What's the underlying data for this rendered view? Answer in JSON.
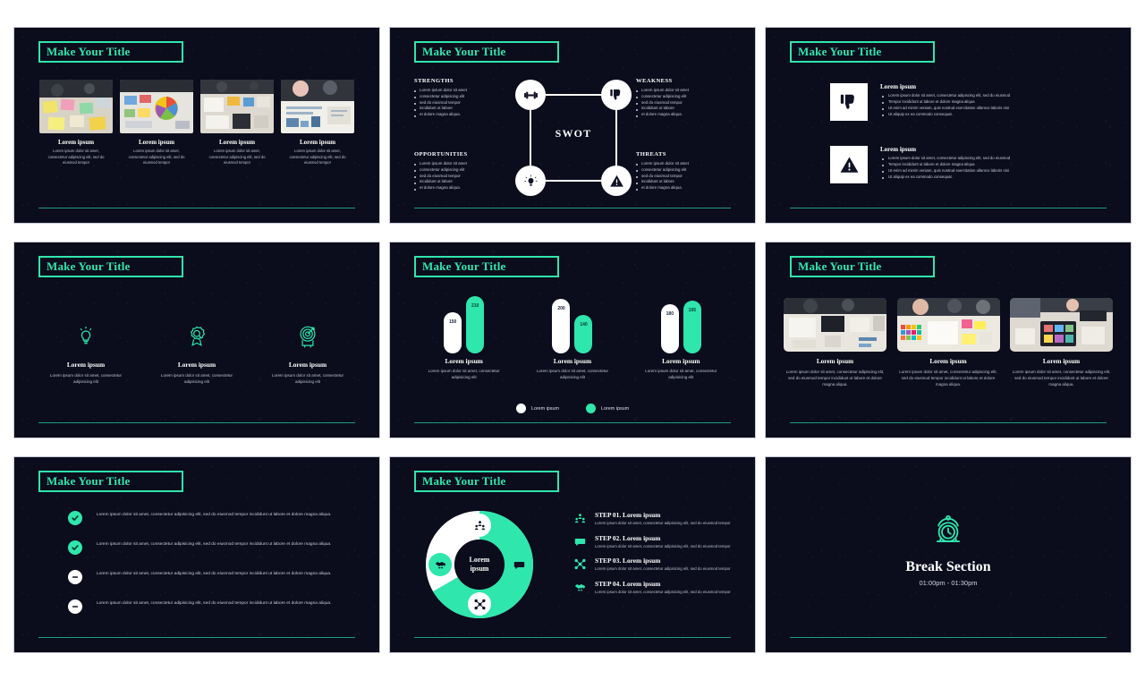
{
  "theme": {
    "accent": "#2fe6ad",
    "background": "#0b0c1c",
    "rule": "#1f9c7c",
    "white": "#ffffff"
  },
  "common": {
    "title": "Make Your Title",
    "lorem_heading": "Lorem ipsum"
  },
  "slides": [
    {
      "id": "slide-photo-grid-4",
      "title": "Make Your Title",
      "cards": [
        {
          "caption": "Lorem ipsum",
          "text": "Lorem ipsum dolor sit amet, consectetur adipiscing elit, sed do eiusmod tempor",
          "image": "team-sticky-notes-photo"
        },
        {
          "caption": "Lorem ipsum",
          "text": "Lorem ipsum dolor sit amet, consectetur adipiscing elit, sed do eiusmod tempor",
          "image": "color-wheel-design-photo"
        },
        {
          "caption": "Lorem ipsum",
          "text": "Lorem ipsum dolor sit amet, consectetur adipiscing elit, sed do eiusmod tempor",
          "image": "desk-wireframes-photo"
        },
        {
          "caption": "Lorem ipsum",
          "text": "Lorem ipsum dolor sit amet, consectetur adipiscing elit, sed do eiusmod tempor",
          "image": "blueprint-meeting-photo"
        }
      ]
    },
    {
      "id": "slide-swot",
      "title": "Make Your Title",
      "center_label": "SWOT",
      "quadrants": [
        {
          "key": "strengths",
          "heading": "STRENGTHS",
          "icon": "dumbbell-icon",
          "items": [
            "Lorem ipsum dolor sit amet",
            "consectetur adipiscing elit",
            "sed do eiusmod tempor",
            "incididunt ut labore",
            "et dolore magna aliqua."
          ]
        },
        {
          "key": "weakness",
          "heading": "WEAKNESS",
          "icon": "thumbs-down-icon",
          "items": [
            "Lorem ipsum dolor sit amet",
            "consectetur adipiscing elit",
            "sed do eiusmod tempor",
            "incididunt ut labore",
            "et dolore magna aliqua."
          ]
        },
        {
          "key": "opportunities",
          "heading": "OPPORTUNITIES",
          "icon": "lightbulb-icon",
          "items": [
            "Lorem ipsum dolor sit amet",
            "consectetur adipiscing elit",
            "sed do eiusmod tempor",
            "incididunt ut labore",
            "et dolore magna aliqua."
          ]
        },
        {
          "key": "threats",
          "heading": "THREATS",
          "icon": "warning-triangle-icon",
          "items": [
            "Lorem ipsum dolor sit amet",
            "consectetur adipiscing elit",
            "sed do eiusmod tempor",
            "incididunt ut labore",
            "et dolore magna aliqua."
          ]
        }
      ]
    },
    {
      "id": "slide-two-icon-rows",
      "title": "Make Your Title",
      "rows": [
        {
          "icon": "thumbs-down-icon",
          "heading": "Lorem ipsum",
          "items": [
            "Lorem ipsum dolor sit amet, consectetur adipiscing elit, sed do eiusmod",
            "Tempor incididunt ut labore et dolore magna aliqua",
            "Ut enim ad minim veniam, quis nostrud exercitation ullamco laboris nisi",
            "Ut aliquip ex ea commodo consequat."
          ]
        },
        {
          "icon": "warning-triangle-icon",
          "heading": "Lorem ipsum",
          "items": [
            "Lorem ipsum dolor sit amet, consectetur adipiscing elit, sed do eiusmod",
            "Tempor incididunt ut labore et dolore magna aliqua",
            "Ut enim ad minim veniam, quis nostrud exercitation ullamco laboris nisi",
            "Ut aliquip ex ea commodo consequat."
          ]
        }
      ]
    },
    {
      "id": "slide-three-icons",
      "title": "Make Your Title",
      "items": [
        {
          "icon": "lightbulb-outline-icon",
          "caption": "Lorem ipsum",
          "text": "Lorem ipsum dolor sit amet, consectetur adipisicing elit"
        },
        {
          "icon": "award-badge-search-icon",
          "caption": "Lorem ipsum",
          "text": "Lorem ipsum dolor sit amet, consectetur adipisicing elit"
        },
        {
          "icon": "target-arrow-icon",
          "caption": "Lorem ipsum",
          "text": "Lorem ipsum dolor sit amet, consectetur adipisicing elit"
        }
      ]
    },
    {
      "id": "slide-bar-chart",
      "title": "Make Your Title",
      "captions": [
        {
          "caption": "Lorem ipsum",
          "text": "Lorem ipsum dolor sit amet, consectetur adipisicing elit"
        },
        {
          "caption": "Lorem ipsum",
          "text": "Lorem ipsum dolor sit amet, consectetur adipisicing elit"
        },
        {
          "caption": "Lorem ipsum",
          "text": "Lorem ipsum dolor sit amet, consectetur adipisicing elit"
        }
      ],
      "legend": [
        {
          "label": "Lorem ipsum",
          "color": "#ffffff"
        },
        {
          "label": "Lorem ipsum",
          "color": "#2fe6ad"
        }
      ]
    },
    {
      "id": "slide-three-photos",
      "title": "Make Your Title",
      "items": [
        {
          "image": "team-desk-sketch-photo",
          "caption": "Lorem ipsum",
          "text": "Lorem ipsum dolor sit amet, consectetur adipiscing elit, sed do eiusmod tempor incididunt ut labore et dolore magna aliqua."
        },
        {
          "image": "colorful-swatches-photo",
          "caption": "Lorem ipsum",
          "text": "Lorem ipsum dolor sit amet, consectetur adipiscing elit, sed do eiusmod tempor incididunt ut labore et dolore magna aliqua."
        },
        {
          "image": "tablet-ui-design-photo",
          "caption": "Lorem ipsum",
          "text": "Lorem ipsum dolor sit amet, consectetur adipiscing elit, sed do eiusmod tempor incididunt ut labore et dolore magna aliqua."
        }
      ]
    },
    {
      "id": "slide-checklist",
      "title": "Make Your Title",
      "rows": [
        {
          "mark": "check-circle-icon",
          "state": "done",
          "text": "Lorem ipsum dolor sit amet, consectetur adipisicing elit, sed do eiusmod tempor incididunt ut labore et dolore magna aliqua."
        },
        {
          "mark": "check-circle-icon",
          "state": "done",
          "text": "Lorem ipsum dolor sit amet, consectetur adipisicing elit, sed do eiusmod tempor incididunt ut labore et dolore magna aliqua."
        },
        {
          "mark": "minus-circle-icon",
          "state": "pending",
          "text": "Lorem ipsum dolor sit amet, consectetur adipisicing elit, sed do eiusmod tempor incididunt ut labore et dolore magna aliqua."
        },
        {
          "mark": "minus-circle-icon",
          "state": "pending",
          "text": "Lorem ipsum dolor sit amet, consectetur adipisicing elit, sed do eiusmod tempor incididunt ut labore et dolore magna aliqua."
        }
      ]
    },
    {
      "id": "slide-donut-steps",
      "title": "Make Your Title",
      "donut_center": "Lorem\nipsum",
      "donut_center_line1": "Lorem",
      "donut_center_line2": "ipsum",
      "steps": [
        {
          "icon": "people-group-icon",
          "heading": "STEP 01. Lorem ipsum",
          "text": "Lorem ipsum dolor sit amet, consectetur adipisicing elit, sed do eiusmod tempor"
        },
        {
          "icon": "chat-bubble-icon",
          "heading": "STEP 02. Lorem ipsum",
          "text": "Lorem ipsum dolor sit amet, consectetur adipisicing elit, sed do eiusmod tempor"
        },
        {
          "icon": "network-nodes-icon",
          "heading": "STEP 03. Lorem ipsum",
          "text": "Lorem ipsum dolor sit amet, consectetur adipisicing elit, sed do eiusmod tempor"
        },
        {
          "icon": "handshake-icon",
          "heading": "STEP 04. Lorem ipsum",
          "text": "Lorem ipsum dolor sit amet, consectetur adipisicing elit, sed do eiusmod tempor"
        }
      ]
    },
    {
      "id": "slide-break-section",
      "icon": "alarm-clock-icon",
      "title": "Break Section",
      "time": "01:00pm - 01:30pm"
    }
  ],
  "chart_data": {
    "type": "bar",
    "title": "Make Your Title",
    "categories": [
      "Lorem ipsum",
      "Lorem ipsum",
      "Lorem ipsum"
    ],
    "series": [
      {
        "name": "Lorem ipsum",
        "color": "#ffffff",
        "values": [
          150,
          200,
          180
        ]
      },
      {
        "name": "Lorem ipsum",
        "color": "#2fe6ad",
        "values": [
          210,
          140,
          195
        ]
      }
    ],
    "xlabel": "",
    "ylabel": "",
    "ylim": [
      0,
      230
    ],
    "grid": false,
    "legend_position": "bottom",
    "data_labels": true
  }
}
